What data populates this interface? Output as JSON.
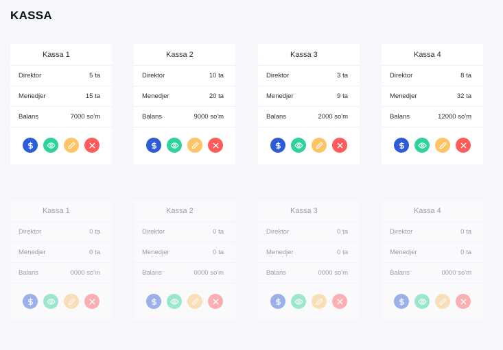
{
  "page": {
    "title": "KASSA"
  },
  "colors": {
    "dollar": "#2e5bd8",
    "view": "#2ed39a",
    "edit": "#ffc463",
    "delete": "#ff5b5b"
  },
  "labels": {
    "director": "Direktor",
    "manager": "Menedjer",
    "balance": "Balans"
  },
  "active_cards": [
    {
      "title": "Kassa 1",
      "director": "5 ta",
      "manager": "15 ta",
      "balance": "7000 so'm"
    },
    {
      "title": "Kassa 2",
      "director": "10 ta",
      "manager": "20 ta",
      "balance": "9000 so'm"
    },
    {
      "title": "Kassa 3",
      "director": "3 ta",
      "manager": "9 ta",
      "balance": "2000 so'm"
    },
    {
      "title": "Kassa 4",
      "director": "8 ta",
      "manager": "32 ta",
      "balance": "12000 so'm"
    }
  ],
  "disabled_cards": [
    {
      "title": "Kassa 1",
      "director": "0 ta",
      "manager": "0 ta",
      "balance": "0000 so'm"
    },
    {
      "title": "Kassa 2",
      "director": "0 ta",
      "manager": "0 ta",
      "balance": "0000 so'm"
    },
    {
      "title": "Kassa 3",
      "director": "0 ta",
      "manager": "0 ta",
      "balance": "0000 so'm"
    },
    {
      "title": "Kassa 4",
      "director": "0 ta",
      "manager": "0 ta",
      "balance": "0000 so'm"
    }
  ],
  "icons": [
    "dollar-icon",
    "eye-icon",
    "pencil-icon",
    "close-icon"
  ]
}
